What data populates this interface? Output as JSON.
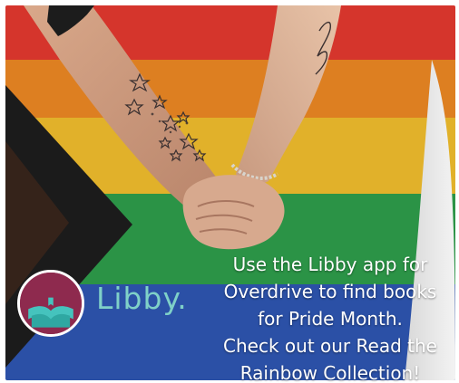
{
  "brand": {
    "name": "Libby.",
    "color": "#7fd0c8",
    "logo_ring_color": "#ffffff",
    "logo_bg_color": "#8e2a4e",
    "logo_book_color": "#45c3bd"
  },
  "caption": {
    "lines": [
      "Use the Libby app for",
      "Overdrive to find books",
      "for Pride Month.",
      "Check out our Read the",
      "Rainbow Collection!"
    ]
  },
  "flag": {
    "stripes": [
      "#e83a30",
      "#f08a24",
      "#f5c02e",
      "#2fa04c",
      "#2f57b5"
    ],
    "chevron_color": "#1b1b1b"
  }
}
